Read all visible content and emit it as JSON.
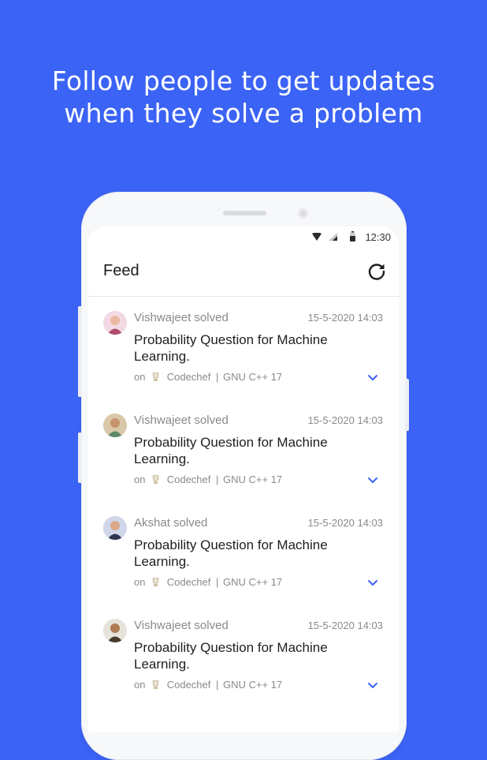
{
  "headline": {
    "line1": "Follow people to get updates",
    "line2": "when they solve a problem"
  },
  "status_bar": {
    "time": "12:30",
    "icons": [
      "wifi-icon",
      "signal-icon",
      "battery-icon"
    ]
  },
  "app_bar": {
    "title": "Feed",
    "refresh_icon": "refresh-icon"
  },
  "feed": {
    "items": [
      {
        "who": "Vishwajeet solved",
        "timestamp": "15-5-2020 14:03",
        "title": "Probability Question for Machine Learning.",
        "on": "on",
        "platform": "Codechef",
        "sep": "|",
        "language": "GNU C++ 17"
      },
      {
        "who": "Vishwajeet solved",
        "timestamp": "15-5-2020 14:03",
        "title": "Probability Question for Machine Learning.",
        "on": "on",
        "platform": "Codechef",
        "sep": "|",
        "language": "GNU C++ 17"
      },
      {
        "who": "Akshat solved",
        "timestamp": "15-5-2020 14:03",
        "title": "Probability Question for Machine Learning.",
        "on": "on",
        "platform": "Codechef",
        "sep": "|",
        "language": "GNU C++ 17"
      },
      {
        "who": "Vishwajeet solved",
        "timestamp": "15-5-2020 14:03",
        "title": "Probability Question for Machine Learning.",
        "on": "on",
        "platform": "Codechef",
        "sep": "|",
        "language": "GNU C++ 17"
      }
    ]
  },
  "colors": {
    "background": "#3b63f5",
    "accent": "#3b63f5",
    "text_primary": "#1f1f1f",
    "text_secondary": "#8a8a8a"
  }
}
